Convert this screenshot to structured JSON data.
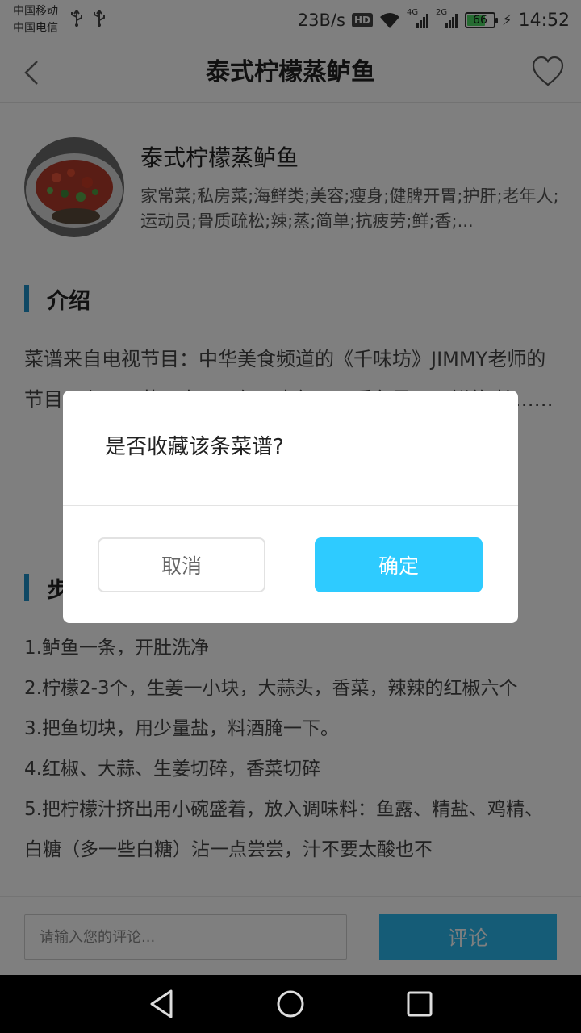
{
  "status_bar": {
    "carrier_1": "中国移动",
    "carrier_2": "中国电信",
    "net_speed": "23B/s",
    "hd_badge": "HD",
    "signal_1_label": "4G",
    "signal_2_label": "2G",
    "battery_level": "66",
    "time": "14:52"
  },
  "nav": {
    "title": "泰式柠檬蒸鲈鱼"
  },
  "recipe": {
    "name": "泰式柠檬蒸鲈鱼",
    "tags": "家常菜;私房菜;海鲜类;美容;瘦身;健脾开胃;护肝;老年人;运动员;骨质疏松;辣;蒸;简单;抗疲劳;鲜;香;..."
  },
  "intro": {
    "heading": "介绍",
    "text": "菜谱来自电视节目：中华美食频道的《千味坊》JIMMY老师的节目，在……节目中……每天中午……看鱼是……鲜的.柠……"
  },
  "steps": {
    "heading": "步骤",
    "items": [
      "1.鲈鱼一条，开肚洗净",
      "2.柠檬2-3个，生姜一小块，大蒜头，香菜，辣辣的红椒六个",
      "3.把鱼切块，用少量盐，料酒腌一下。",
      "4.红椒、大蒜、生姜切碎，香菜切碎",
      "5.把柠檬汁挤出用小碗盛着，放入调味料：鱼露、精盐、鸡精、白糖（多一些白糖）沾一点尝尝，汁不要太酸也不"
    ]
  },
  "comment": {
    "placeholder": "请输入您的评论...",
    "submit_label": "评论"
  },
  "dialog": {
    "message": "是否收藏该条菜谱?",
    "cancel_label": "取消",
    "confirm_label": "确定"
  }
}
